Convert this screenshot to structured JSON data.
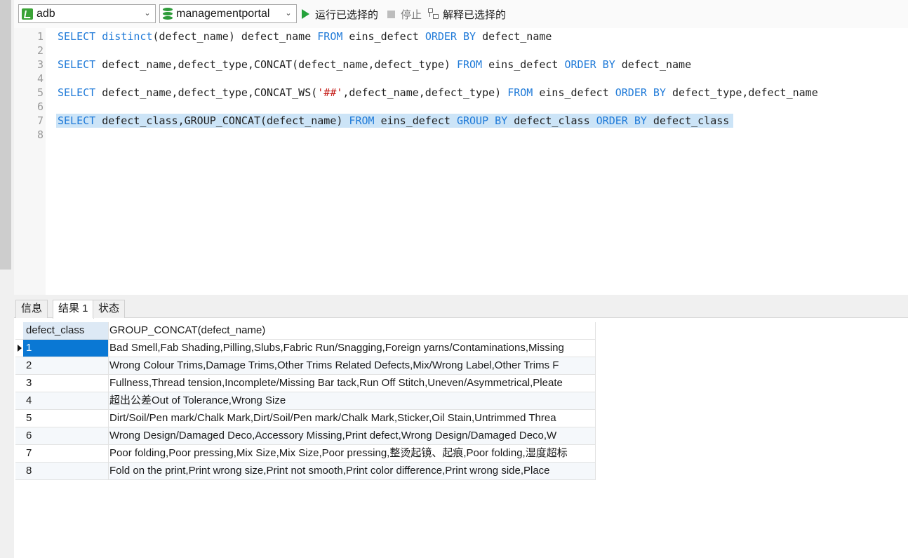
{
  "toolbar": {
    "connection": "adb",
    "database": "managementportal",
    "run_label": "运行已选择的",
    "stop_label": "停止",
    "explain_label": "解释已选择的"
  },
  "editor": {
    "lines": [
      {
        "n": "1",
        "tokens": [
          [
            "kw",
            "SELECT"
          ],
          [
            "t",
            " "
          ],
          [
            "kw",
            "distinct"
          ],
          [
            "t",
            "(defect_name) defect_name "
          ],
          [
            "kw",
            "FROM"
          ],
          [
            "t",
            " eins_defect "
          ],
          [
            "kw",
            "ORDER BY"
          ],
          [
            "t",
            " defect_name"
          ]
        ]
      },
      {
        "n": "2",
        "tokens": []
      },
      {
        "n": "3",
        "tokens": [
          [
            "kw",
            "SELECT"
          ],
          [
            "t",
            " defect_name,defect_type,CONCAT(defect_name,defect_type) "
          ],
          [
            "kw",
            "FROM"
          ],
          [
            "t",
            " eins_defect "
          ],
          [
            "kw",
            "ORDER BY"
          ],
          [
            "t",
            " defect_name"
          ]
        ]
      },
      {
        "n": "4",
        "tokens": []
      },
      {
        "n": "5",
        "tokens": [
          [
            "kw",
            "SELECT"
          ],
          [
            "t",
            " defect_name,defect_type,CONCAT_WS("
          ],
          [
            "str",
            "'##'"
          ],
          [
            "t",
            ",defect_name,defect_type) "
          ],
          [
            "kw",
            "FROM"
          ],
          [
            "t",
            " eins_defect "
          ],
          [
            "kw",
            "ORDER BY"
          ],
          [
            "t",
            " defect_type,defect_name"
          ]
        ]
      },
      {
        "n": "6",
        "tokens": []
      },
      {
        "n": "7",
        "selected": true,
        "tokens": [
          [
            "kw",
            "SELECT"
          ],
          [
            "t",
            " defect_class,GROUP_CONCAT(defect_name) "
          ],
          [
            "kw",
            "FROM"
          ],
          [
            "t",
            " eins_defect "
          ],
          [
            "kw",
            "GROUP BY"
          ],
          [
            "t",
            " defect_class "
          ],
          [
            "kw",
            "ORDER BY"
          ],
          [
            "t",
            " defect_class"
          ]
        ]
      },
      {
        "n": "8",
        "tokens": []
      }
    ]
  },
  "tabs": [
    "信息",
    "结果 1",
    "状态"
  ],
  "result": {
    "columns": [
      "defect_class",
      "GROUP_CONCAT(defect_name)"
    ],
    "rows": [
      [
        "1",
        "Bad Smell,Fab Shading,Pilling,Slubs,Fabric Run/Snagging,Foreign yarns/Contaminations,Missing"
      ],
      [
        "2",
        "Wrong Colour Trims,Damage Trims,Other Trims Related Defects,Mix/Wrong Label,Other Trims F"
      ],
      [
        "3",
        "Fullness,Thread tension,Incomplete/Missing Bar tack,Run Off Stitch,Uneven/Asymmetrical,Pleate"
      ],
      [
        "4",
        "超出公差Out of Tolerance,Wrong Size"
      ],
      [
        "5",
        "Dirt/Soil/Pen mark/Chalk Mark,Dirt/Soil/Pen mark/Chalk Mark,Sticker,Oil Stain,Untrimmed Threa"
      ],
      [
        "6",
        "Wrong Design/Damaged Deco,Accessory Missing,Print defect,Wrong Design/Damaged Deco,W"
      ],
      [
        "7",
        "Poor folding,Poor pressing,Mix Size,Mix Size,Poor pressing,整烫起镜、起痕,Poor folding,湿度超标"
      ],
      [
        "8",
        "Fold on the print,Print wrong size,Print not smooth,Print color difference,Print wrong side,Place"
      ]
    ]
  }
}
